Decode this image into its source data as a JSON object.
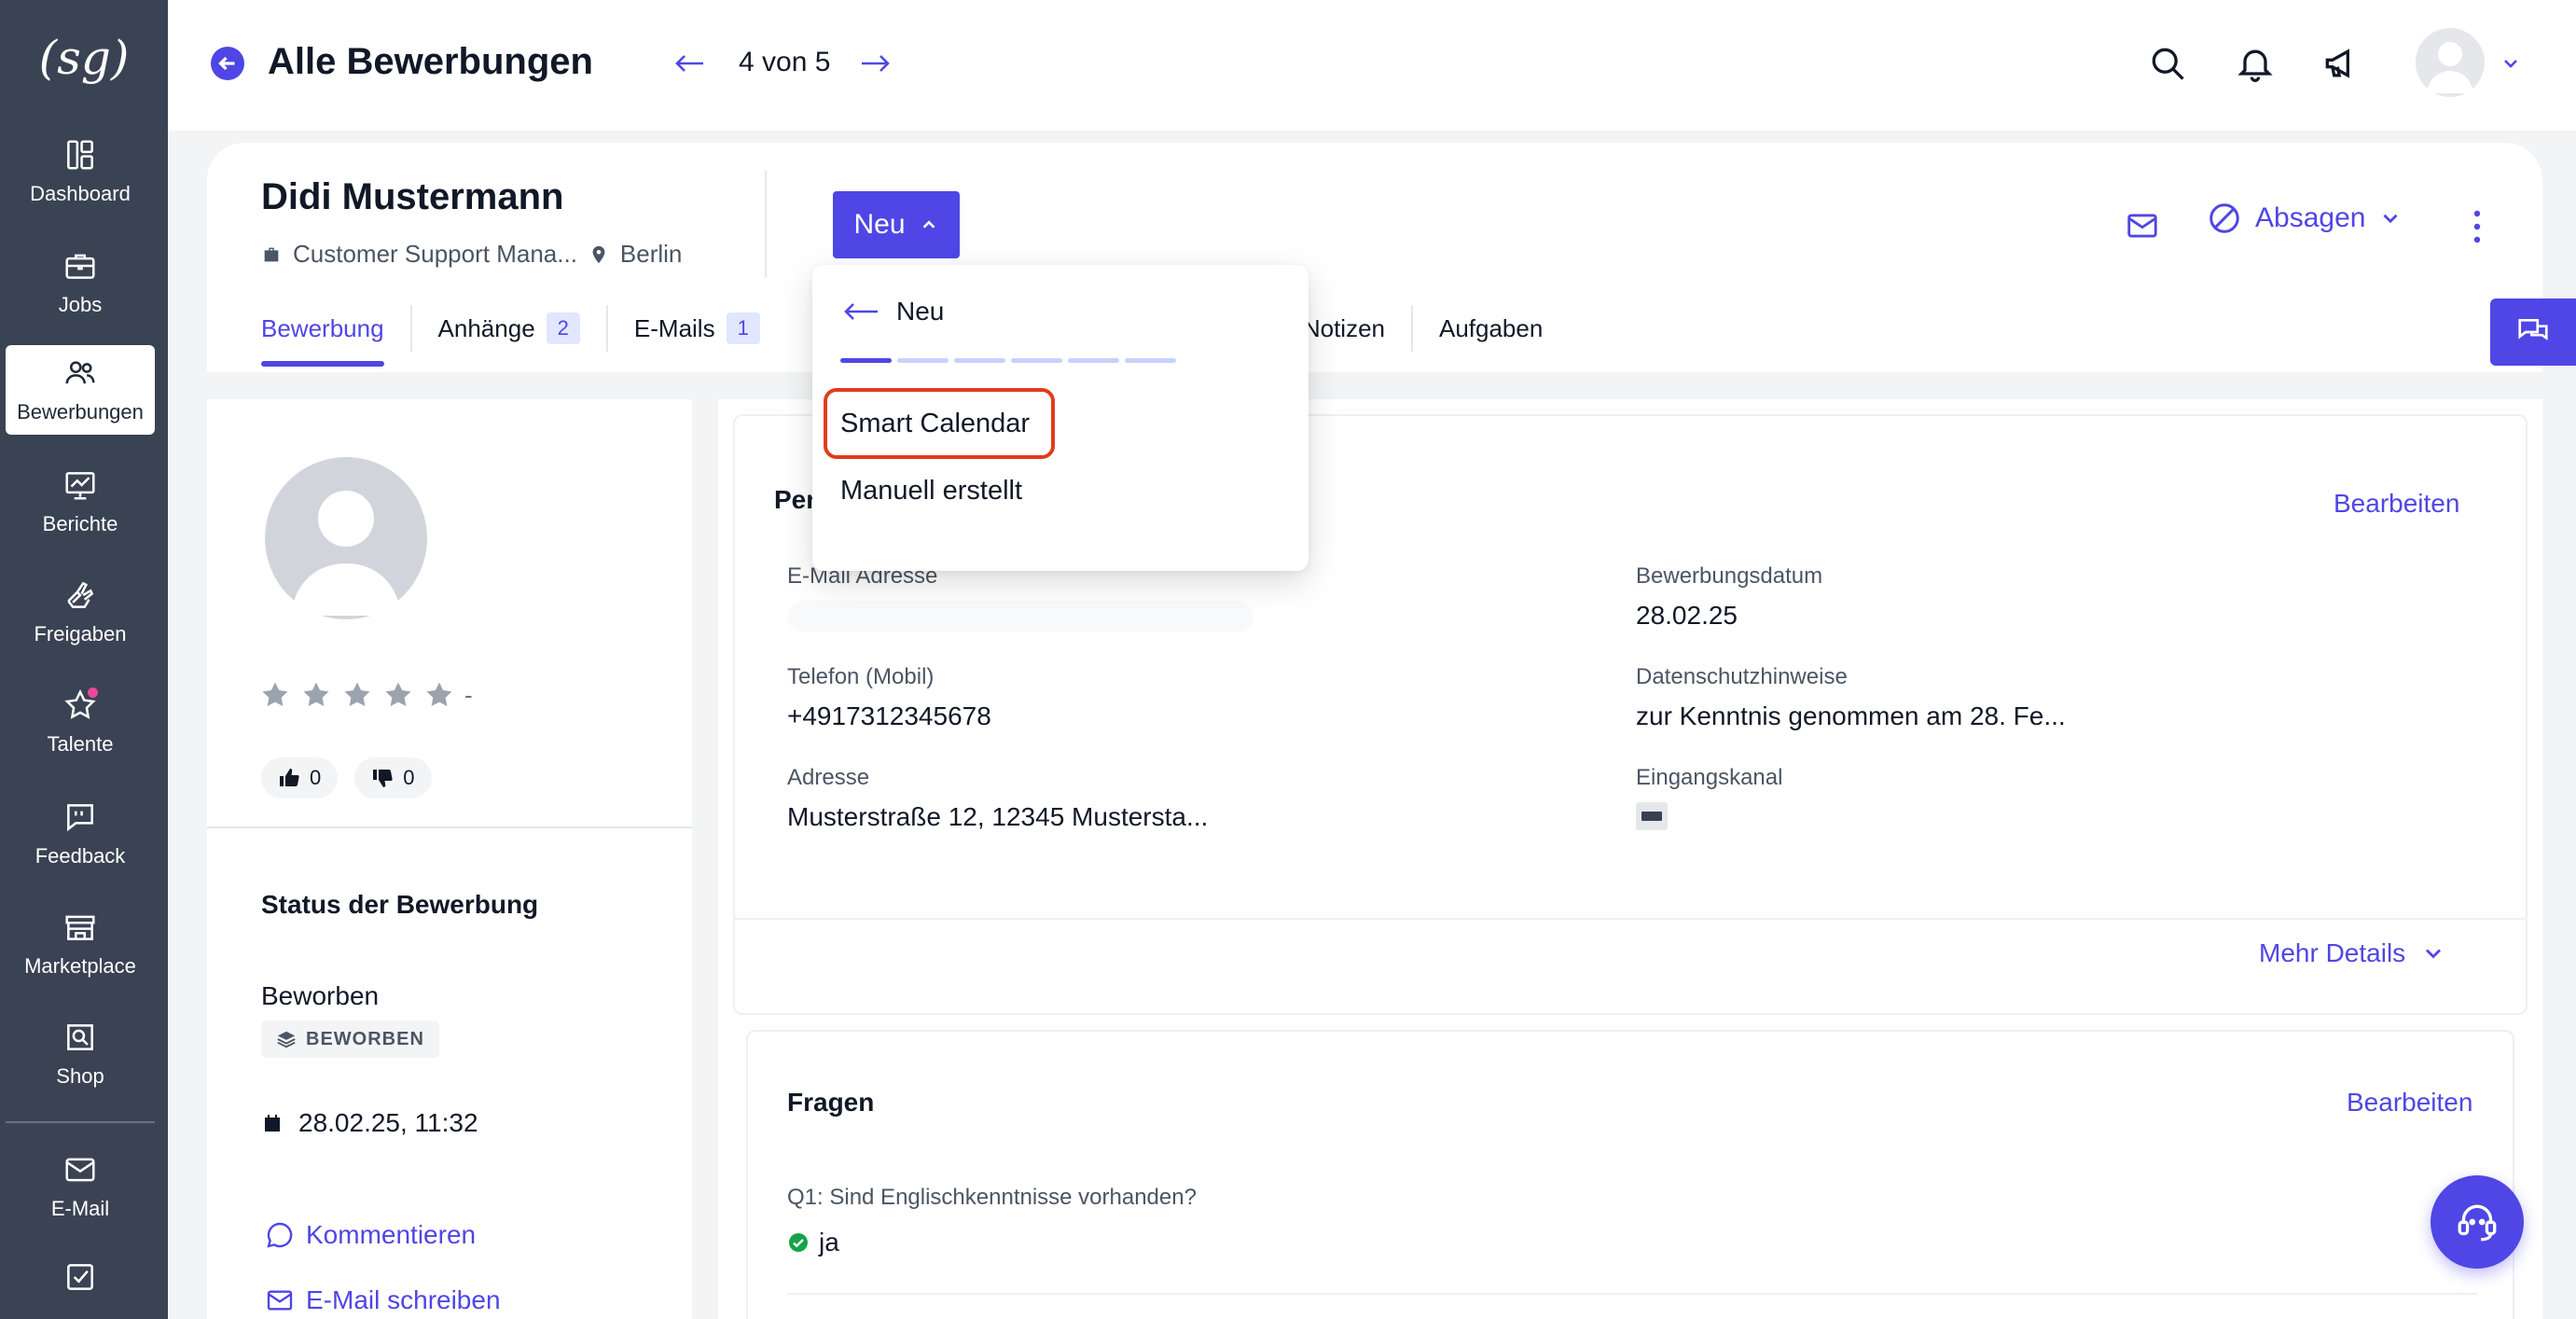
{
  "brand": {
    "logo": "(sg)",
    "accent": "#4f46e5",
    "sidebar_bg": "#3a4353"
  },
  "sidebar": {
    "items": [
      {
        "label": "Dashboard",
        "icon": "dashboard-icon"
      },
      {
        "label": "Jobs",
        "icon": "briefcase-icon"
      },
      {
        "label": "Bewerbungen",
        "icon": "users-icon",
        "active": true
      },
      {
        "label": "Berichte",
        "icon": "chart-board-icon"
      },
      {
        "label": "Freigaben",
        "icon": "approval-hand-icon"
      },
      {
        "label": "Talente",
        "icon": "star-icon",
        "has_notification": true
      },
      {
        "label": "Feedback",
        "icon": "feedback-bubble-icon"
      },
      {
        "label": "Marketplace",
        "icon": "store-icon"
      },
      {
        "label": "Shop",
        "icon": "shop-search-icon"
      },
      {
        "label": "E-Mail",
        "icon": "mail-icon"
      },
      {
        "label": "",
        "icon": "checkbox-icon"
      }
    ]
  },
  "topbar": {
    "title": "Alle Bewerbungen",
    "pager": "4 von 5",
    "icons": [
      "search-icon",
      "bell-icon",
      "megaphone-icon"
    ]
  },
  "candidate": {
    "name": "Didi Mustermann",
    "job": "Customer Support Mana...",
    "location": "Berlin",
    "status_button": "Neu",
    "reject_label": "Absagen"
  },
  "tabs": [
    {
      "label": "Bewerbung",
      "active": true
    },
    {
      "label": "Anhänge",
      "badge": "2"
    },
    {
      "label": "E-Mails",
      "badge": "1"
    },
    {
      "label": "Notizen"
    },
    {
      "label": "Aufgaben"
    }
  ],
  "dropdown": {
    "back_label": "Neu",
    "steps_total": 6,
    "steps_done": 1,
    "options": [
      "Smart Calendar",
      "Manuell erstellt"
    ],
    "highlighted": "Smart Calendar"
  },
  "left_panel": {
    "rating_value": "-",
    "thumbs_up": "0",
    "thumbs_down": "0",
    "status_title": "Status der Bewerbung",
    "status_value": "Beworben",
    "status_chip": "BEWORBEN",
    "date": "28.02.25, 11:32",
    "comment_label": "Kommentieren",
    "mail_label": "E-Mail schreiben"
  },
  "personal": {
    "title_partial": "Per",
    "edit_label": "Bearbeiten",
    "fields": {
      "email": {
        "label": "E-Mail Adresse",
        "value": ""
      },
      "date": {
        "label": "Bewerbungsdatum",
        "value": "28.02.25"
      },
      "phone": {
        "label": "Telefon (Mobil)",
        "value": "+4917312345678"
      },
      "privacy": {
        "label": "Datenschutzhinweise",
        "value": "zur Kenntnis genommen am 28. Fe..."
      },
      "address": {
        "label": "Adresse",
        "value": "Musterstraße 12, 12345 Mustersta..."
      },
      "channel": {
        "label": "Eingangskanal",
        "value": ""
      }
    },
    "more_details": "Mehr Details"
  },
  "questions": {
    "title": "Fragen",
    "edit_label": "Bearbeiten",
    "q1": "Q1: Sind Englischkenntnisse vorhanden?",
    "a1": "ja"
  }
}
